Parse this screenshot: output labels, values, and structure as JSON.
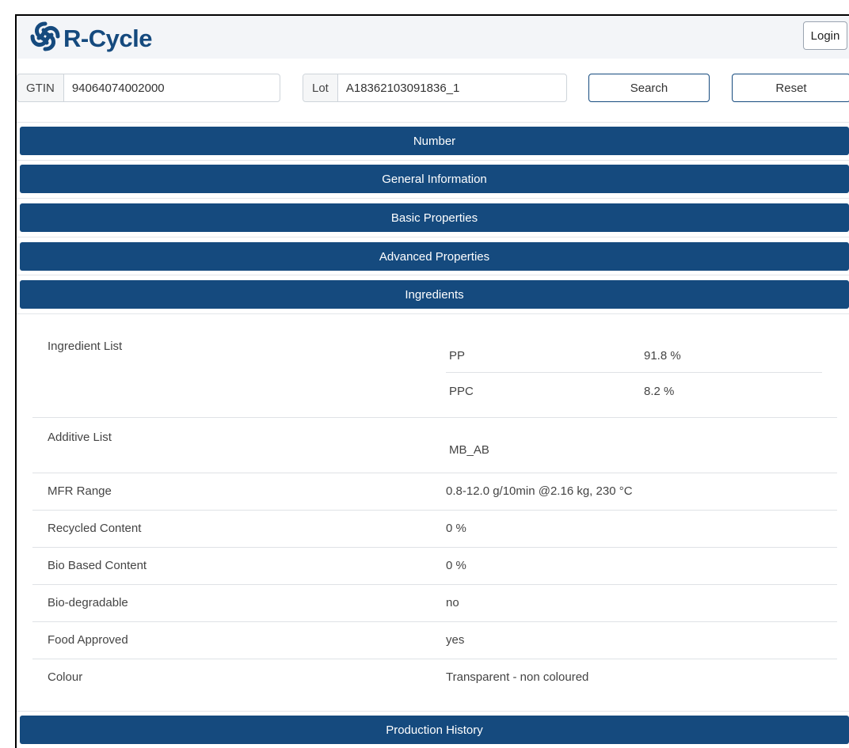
{
  "brand": {
    "name": "R-Cycle",
    "color": "#154a7e"
  },
  "header": {
    "login_label": "Login"
  },
  "search": {
    "gtin_label": "GTIN",
    "gtin_value": "94064074002000",
    "lot_label": "Lot",
    "lot_value": "A18362103091836_1",
    "search_label": "Search",
    "reset_label": "Reset"
  },
  "sections": [
    {
      "label": "Number"
    },
    {
      "label": "General Information"
    },
    {
      "label": "Basic Properties"
    },
    {
      "label": "Advanced Properties"
    },
    {
      "label": "Ingredients"
    },
    {
      "label": "Production History"
    }
  ],
  "ingredients": {
    "ingredient_list_label": "Ingredient List",
    "ingredient_list": [
      {
        "name": "PP",
        "percent": "91.8 %"
      },
      {
        "name": "PPC",
        "percent": "8.2 %"
      }
    ],
    "additive_list_label": "Additive List",
    "additive_list": [
      "MB_AB"
    ],
    "properties": [
      {
        "label": "MFR Range",
        "value": "0.8-12.0 g/10min @2.16 kg, 230 °C"
      },
      {
        "label": "Recycled Content",
        "value": "0 %"
      },
      {
        "label": "Bio Based Content",
        "value": "0 %"
      },
      {
        "label": "Bio-degradable",
        "value": "no"
      },
      {
        "label": "Food Approved",
        "value": "yes"
      },
      {
        "label": "Colour",
        "value": "Transparent - non coloured"
      }
    ]
  }
}
